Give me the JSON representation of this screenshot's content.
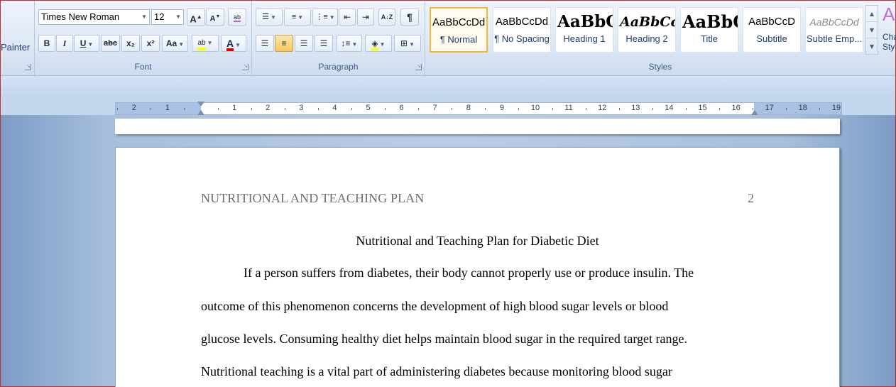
{
  "clipboard": {
    "format_painter_label": "Painter"
  },
  "font_group": {
    "label": "Font",
    "font_name": "Times New Roman",
    "font_size": "12",
    "grow_font": "A",
    "shrink_font": "A",
    "clear_formatting": "ab",
    "bold": "B",
    "italic": "I",
    "underline": "U",
    "strikethrough": "abc",
    "subscript": "x₂",
    "superscript": "x²",
    "change_case": "Aa",
    "highlight": "ab",
    "font_color": "A",
    "highlight_color": "#ffff00",
    "font_color_value": "#e00000"
  },
  "paragraph_group": {
    "label": "Paragraph",
    "show_marks": "¶",
    "sort": "A↓Z"
  },
  "styles_group": {
    "label": "Styles",
    "items": [
      {
        "sample": "AaBbCcDd",
        "name": "¶ Normal"
      },
      {
        "sample": "AaBbCcDd",
        "name": "¶ No Spacing"
      },
      {
        "sample": "AaBbC",
        "name": "Heading 1"
      },
      {
        "sample": "AaBbCc",
        "name": "Heading 2"
      },
      {
        "sample": "AaBbC",
        "name": "Title"
      },
      {
        "sample": "AaBbCcD",
        "name": "Subtitle"
      },
      {
        "sample": "AaBbCcDd",
        "name": "Subtle Emp..."
      }
    ],
    "change_styles_line1": "Cha",
    "change_styles_line2": "Sty"
  },
  "ruler": {
    "left_labels": [
      "2",
      "1"
    ],
    "right_labels": [
      "1",
      "2",
      "3",
      "4",
      "5",
      "6",
      "7",
      "8",
      "9",
      "10",
      "11",
      "12",
      "13",
      "14",
      "15",
      "16",
      "17",
      "18",
      "19"
    ]
  },
  "document": {
    "running_head": "NUTRITIONAL AND TEACHING PLAN",
    "page_number": "2",
    "title": "Nutritional and Teaching Plan for Diabetic Diet",
    "lines": [
      "If a person suffers from diabetes, their body cannot properly use or produce insulin. The",
      "outcome of this phenomenon concerns the development of high blood sugar levels or blood",
      "glucose levels. Consuming healthy diet helps maintain blood sugar in the required target range.",
      "Nutritional teaching is a vital part of administering diabetes because monitoring blood sugar"
    ]
  }
}
